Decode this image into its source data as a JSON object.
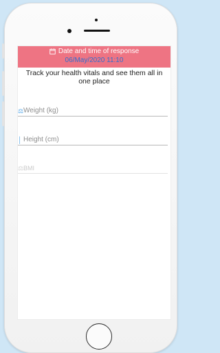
{
  "banner": {
    "title": "Date and time of response",
    "date": "06/May/2020 11:10",
    "icon": "calendar-icon"
  },
  "headline": "Track your health vitals and see them all in one place",
  "fields": [
    {
      "placeholder": "Weight (kg)",
      "icon": "scale-icon"
    },
    {
      "placeholder": "Height (cm)",
      "icon": "ruler-icon"
    },
    {
      "placeholder": "BMI",
      "icon": "bmi-icon"
    }
  ],
  "colors": {
    "banner": "#ee7483",
    "date": "#2f6fd0",
    "field_icon": "#4da3e6"
  }
}
